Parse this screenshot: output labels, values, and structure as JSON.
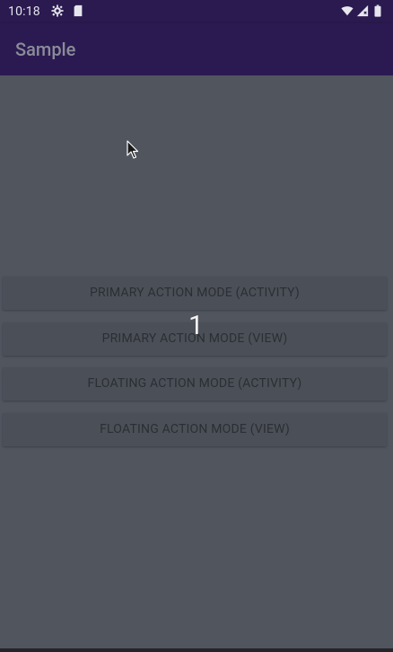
{
  "status_bar": {
    "time": "10:18",
    "icons": [
      "gear-icon",
      "sd-card-icon",
      "wifi-icon",
      "signal-icon",
      "battery-icon"
    ]
  },
  "app_bar": {
    "title": "Sample"
  },
  "buttons": [
    {
      "label": "PRIMARY ACTION MODE (ACTIVITY)"
    },
    {
      "label": "PRIMARY ACTION MODE (VIEW)"
    },
    {
      "label": "FLOATING ACTION MODE (ACTIVITY)"
    },
    {
      "label": "FLOATING ACTION MODE (VIEW)"
    }
  ],
  "overlay_number": "1",
  "colors": {
    "status_bar": "#2a1a4f",
    "app_bar": "#2b1a51",
    "background": "#50555e",
    "button": "#4b5058"
  }
}
